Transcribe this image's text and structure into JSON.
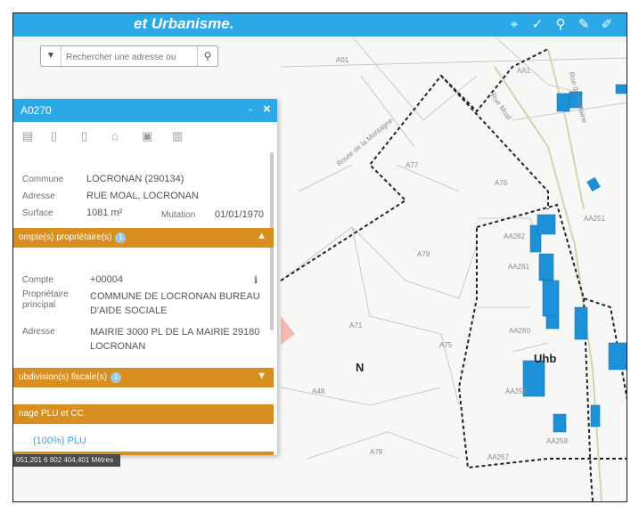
{
  "app": {
    "title": "et Urbanisme."
  },
  "toolbar": {
    "tools": [
      "pin-doc-icon",
      "pin-check-icon",
      "pin-person-icon",
      "pencil-icon",
      "pencil-alt-icon"
    ]
  },
  "search": {
    "placeholder": "Rechercher une adresse ou"
  },
  "panel": {
    "title": "A0270",
    "close": "×",
    "minimize": "-",
    "info": {
      "commune_label": "Commune",
      "commune_value": "LOCRONAN (290134)",
      "adresse_label": "Adresse",
      "adresse_value": "RUE MOAL, LOCRONAN",
      "surface_label": "Surface",
      "surface_value": "1081 m²",
      "mutation_label": "Mutation",
      "mutation_value": "01/01/1970"
    },
    "owners_section": {
      "title": "ompte(s) propriétaire(s)",
      "badge": "1"
    },
    "owner": {
      "compte_label": "Compte",
      "compte_value": "+00004",
      "proprietaire_label": "Propriétaire principal",
      "proprietaire_value": "COMMUNE DE LOCRONAN BUREAU D'AIDE SOCIALE",
      "adresse_label": "Adresse",
      "adresse_value": "MAIRIE 3000 PL DE LA MAIRIE 29180 LOCRONAN"
    },
    "subdivision_section": {
      "title": "ubdivision(s) fiscale(s)",
      "badge": "1"
    },
    "zonage_section": {
      "title": "nage PLU et CC"
    },
    "plu_value": "(100%) PLU"
  },
  "status": {
    "coords": "051,201 6 802 404,401 Mètres"
  },
  "map": {
    "zones": [
      "N",
      "Uhb"
    ],
    "parcels": [
      "A01",
      "AA1",
      "A77",
      "A79",
      "A76",
      "A75",
      "A71",
      "A78",
      "AA262",
      "AA261",
      "AA260",
      "AA259",
      "AA251",
      "A48",
      "AA258",
      "AA257"
    ],
    "streets": [
      "Route de la Montagne",
      "Rue Moal",
      "Rue de Fontaine"
    ]
  }
}
